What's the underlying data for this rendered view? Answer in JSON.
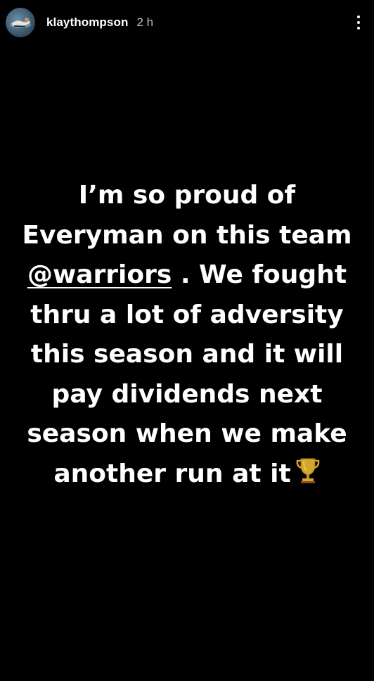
{
  "header": {
    "username": "klaythompson",
    "timestamp": "2 h",
    "more_icon": "more-vertical-icon",
    "avatar_icon": "profile-avatar"
  },
  "story": {
    "text_before_mention": "I’m so proud of Everyman on this team ",
    "mention": "@warriors",
    "text_after_mention": " . We fought thru a lot of adversity this season and it will pay dividends next season when we make another run at it",
    "emoji": "trophy-icon"
  },
  "colors": {
    "background": "#000000",
    "text": "#ffffff",
    "timestamp": "#bdbdbd",
    "trophy": "#d4a72c"
  }
}
